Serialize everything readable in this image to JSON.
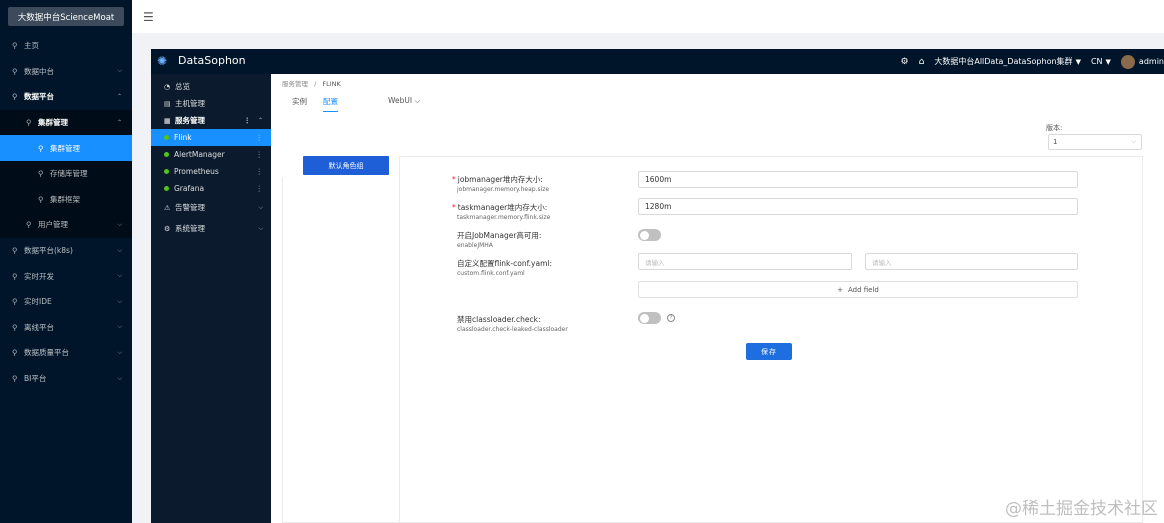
{
  "outer_sidebar": {
    "brand": "大数据中台ScienceMoat",
    "items": [
      {
        "label": "主页"
      },
      {
        "label": "数据中台"
      },
      {
        "label": "数据平台"
      },
      {
        "label": "集群管理"
      },
      {
        "label": "集群管理"
      },
      {
        "label": "存储库管理"
      },
      {
        "label": "集群框架"
      },
      {
        "label": "用户管理"
      },
      {
        "label": "数据平台(k8s)"
      },
      {
        "label": "实时开发"
      },
      {
        "label": "实时IDE"
      },
      {
        "label": "离线平台"
      },
      {
        "label": "数据质量平台"
      },
      {
        "label": "BI平台"
      }
    ]
  },
  "topbar": {
    "menu_icon": "menu-fold-icon"
  },
  "inner_header": {
    "app_name": "DataSophon",
    "cluster": "大数据中台AllData_DataSophon集群",
    "lang": "CN",
    "user": "admin"
  },
  "inner_sidebar": {
    "items": [
      {
        "label": "总览"
      },
      {
        "label": "主机管理"
      },
      {
        "label": "服务管理"
      },
      {
        "label": "Flink"
      },
      {
        "label": "AlertManager"
      },
      {
        "label": "Prometheus"
      },
      {
        "label": "Grafana"
      },
      {
        "label": "告警管理"
      },
      {
        "label": "系统管理"
      }
    ]
  },
  "breadcrumb": {
    "parent": "服务管理",
    "sep": "/",
    "current": "FLINK"
  },
  "tabs": [
    {
      "label": "实例"
    },
    {
      "label": "配置"
    }
  ],
  "webui": "WebUI",
  "version": {
    "label": "版本:",
    "value": "1"
  },
  "role_group_button": "默认角色组",
  "form": {
    "jm_heap": {
      "label": "jobmanager堆内存大小:",
      "key": "jobmanager.memory.heap.size",
      "value": "1600m"
    },
    "tm_flink": {
      "label": "taskmanager堆内存大小:",
      "key": "taskmanager.memory.flink.size",
      "value": "1280m"
    },
    "jm_ha": {
      "label": "开启JobManager高可用:",
      "key": "enableJMHA"
    },
    "custom_conf": {
      "label": "自定义配置flink-conf.yaml:",
      "key": "custom.flink.conf.yaml",
      "placeholder1": "请输入",
      "placeholder2": "请输入",
      "add_field": "Add field"
    },
    "classloader": {
      "label": "禁用classloader.check:",
      "key": "classloader.check-leaked-classloader"
    },
    "save": "保存"
  },
  "watermark": "@稀土掘金技术社区"
}
